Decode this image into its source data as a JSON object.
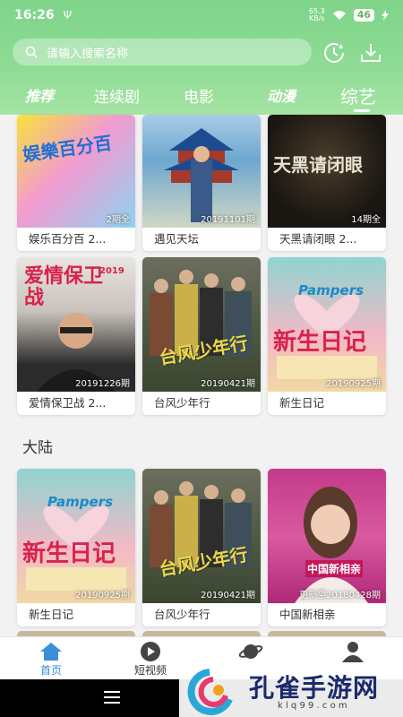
{
  "status_bar": {
    "time": "16:26",
    "usb": "Ψ",
    "net_speed_top": "65.3",
    "net_speed_bottom": "KB/s",
    "battery": "46"
  },
  "search": {
    "placeholder": "请输入搜索名称"
  },
  "tabs": [
    "推荐",
    "连续剧",
    "电影",
    "动漫",
    "综艺"
  ],
  "active_tab": "综艺",
  "row1": [
    {
      "title": "娱乐百分百 2...",
      "badge": "2期全",
      "poster_text": "娱樂百分百"
    },
    {
      "title": "遇见天坛",
      "badge": "20191101期",
      "poster_text": ""
    },
    {
      "title": "天黑请闭眼 2...",
      "badge": "14期全",
      "poster_text": "天黑请闭眼"
    }
  ],
  "row2": [
    {
      "title": "爱情保卫战 2...",
      "badge": "20191226期",
      "poster_text": "爱情保卫战",
      "poster_year": "2019"
    },
    {
      "title": "台风少年行",
      "badge": "20190421期",
      "poster_text": "台风少年行"
    },
    {
      "title": "新生日记",
      "badge": "20190925期",
      "poster_text": "新生日记",
      "brand": "Pampers"
    }
  ],
  "section": {
    "title": "大陆"
  },
  "row3": [
    {
      "title": "新生日记",
      "badge": "20190925期",
      "poster_text": "新生日记",
      "brand": "Pampers"
    },
    {
      "title": "台风少年行",
      "badge": "20190421期",
      "poster_text": "台风少年行"
    },
    {
      "title": "中国新相亲",
      "badge": "更新至20180428期",
      "poster_text": "中国新相亲"
    }
  ],
  "bottom_nav": [
    {
      "label": "首页",
      "icon": "home-icon"
    },
    {
      "label": "短视频",
      "icon": "play-icon"
    },
    {
      "label": "",
      "icon": "planet-icon"
    },
    {
      "label": "",
      "icon": "user-icon"
    }
  ],
  "watermark": {
    "text": "孔雀手游网",
    "url": "k l q 9 9 . c o m"
  },
  "colors": {
    "header_green": "#8fdc95",
    "active_blue": "#3b8fd8"
  }
}
